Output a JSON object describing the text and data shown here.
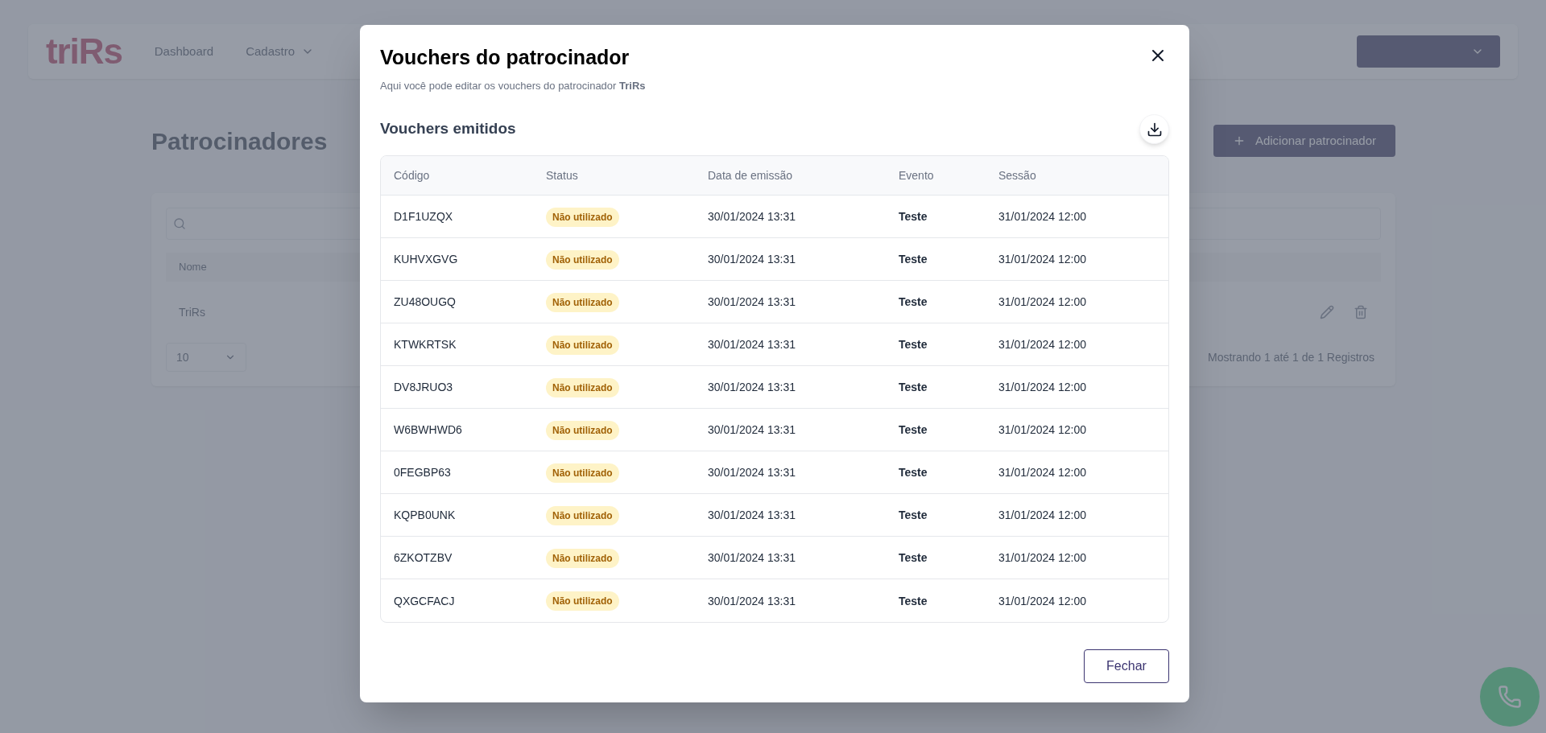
{
  "nav": {
    "logo": "triRs",
    "links": [
      {
        "label": "Dashboard",
        "dropdown": false
      },
      {
        "label": "Cadastro",
        "dropdown": true
      }
    ]
  },
  "page": {
    "title": "Patrocinadores",
    "add_button": "Adicionar patrocinador",
    "table": {
      "columns": [
        "Nome"
      ],
      "rows": [
        [
          "TriRs"
        ]
      ]
    },
    "page_size": "10",
    "summary": "Mostrando 1 até 1 de 1 Registros"
  },
  "modal": {
    "title": "Vouchers do patrocinador",
    "subtitle": "Aqui você pode editar os vouchers do patrocinador **TriRs**",
    "section_title": "Vouchers emitidos",
    "table": {
      "columns": [
        "Código",
        "Status",
        "Data de emissão",
        "Evento",
        "Sessão"
      ],
      "rows": [
        {
          "code": "D1F1UZQX",
          "status": "Não utilizado",
          "issued": "30/01/2024 13:31",
          "event": "Teste",
          "session": "31/01/2024 12:00"
        },
        {
          "code": "KUHVXGVG",
          "status": "Não utilizado",
          "issued": "30/01/2024 13:31",
          "event": "Teste",
          "session": "31/01/2024 12:00"
        },
        {
          "code": "ZU48OUGQ",
          "status": "Não utilizado",
          "issued": "30/01/2024 13:31",
          "event": "Teste",
          "session": "31/01/2024 12:00"
        },
        {
          "code": "KTWKRTSK",
          "status": "Não utilizado",
          "issued": "30/01/2024 13:31",
          "event": "Teste",
          "session": "31/01/2024 12:00"
        },
        {
          "code": "DV8JRUO3",
          "status": "Não utilizado",
          "issued": "30/01/2024 13:31",
          "event": "Teste",
          "session": "31/01/2024 12:00"
        },
        {
          "code": "W6BWHWD6",
          "status": "Não utilizado",
          "issued": "30/01/2024 13:31",
          "event": "Teste",
          "session": "31/01/2024 12:00"
        },
        {
          "code": "0FEGBP63",
          "status": "Não utilizado",
          "issued": "30/01/2024 13:31",
          "event": "Teste",
          "session": "31/01/2024 12:00"
        },
        {
          "code": "KQPB0UNK",
          "status": "Não utilizado",
          "issued": "30/01/2024 13:31",
          "event": "Teste",
          "session": "31/01/2024 12:00"
        },
        {
          "code": "6ZKOTZBV",
          "status": "Não utilizado",
          "issued": "30/01/2024 13:31",
          "event": "Teste",
          "session": "31/01/2024 12:00"
        },
        {
          "code": "QXGCFACJ",
          "status": "Não utilizado",
          "issued": "30/01/2024 13:31",
          "event": "Teste",
          "session": "31/01/2024 12:00"
        }
      ]
    },
    "close_button": "Fechar"
  }
}
